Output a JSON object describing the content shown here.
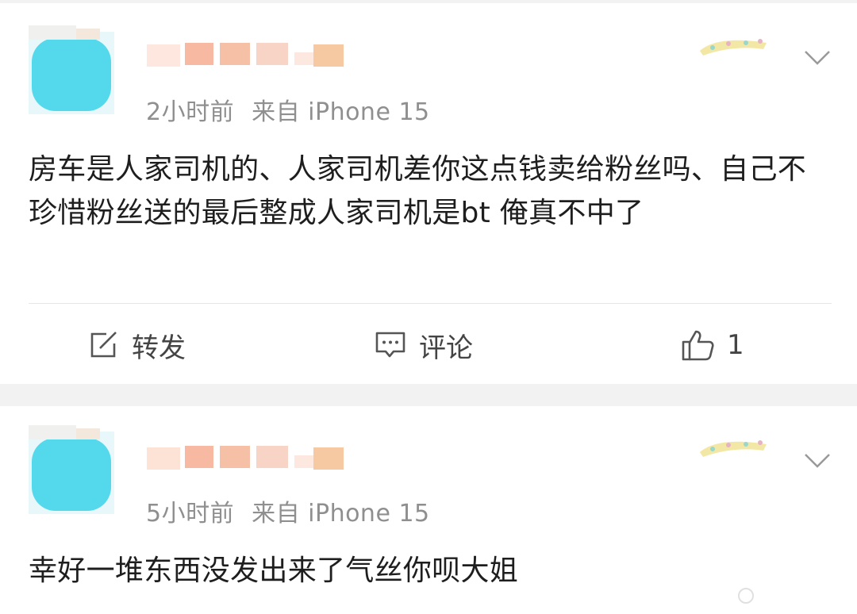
{
  "posts": [
    {
      "time": "2小时前",
      "source_prefix": "来自",
      "source": "iPhone 15",
      "text": "房车是人家司机的、人家司机差你这点钱卖给粉丝吗、自己不珍惜粉丝送的最后整成人家司机是bt 俺真不中了",
      "actions": {
        "repost": "转发",
        "comment": "评论",
        "like_count": "1"
      }
    },
    {
      "time": "5小时前",
      "source_prefix": "来自",
      "source": "iPhone 15",
      "text": "幸好一堆东西没发出来了气丝你呗大姐"
    }
  ],
  "icons": {
    "repost": "edit-square-icon",
    "comment": "comment-bubble-icon",
    "like": "thumbs-up-icon",
    "menu": "chevron-down-icon"
  },
  "colors": {
    "avatar": "#54d9ec",
    "meta": "#8f8f8f",
    "text": "#1e1e1e",
    "background": "#f2f2f2"
  }
}
